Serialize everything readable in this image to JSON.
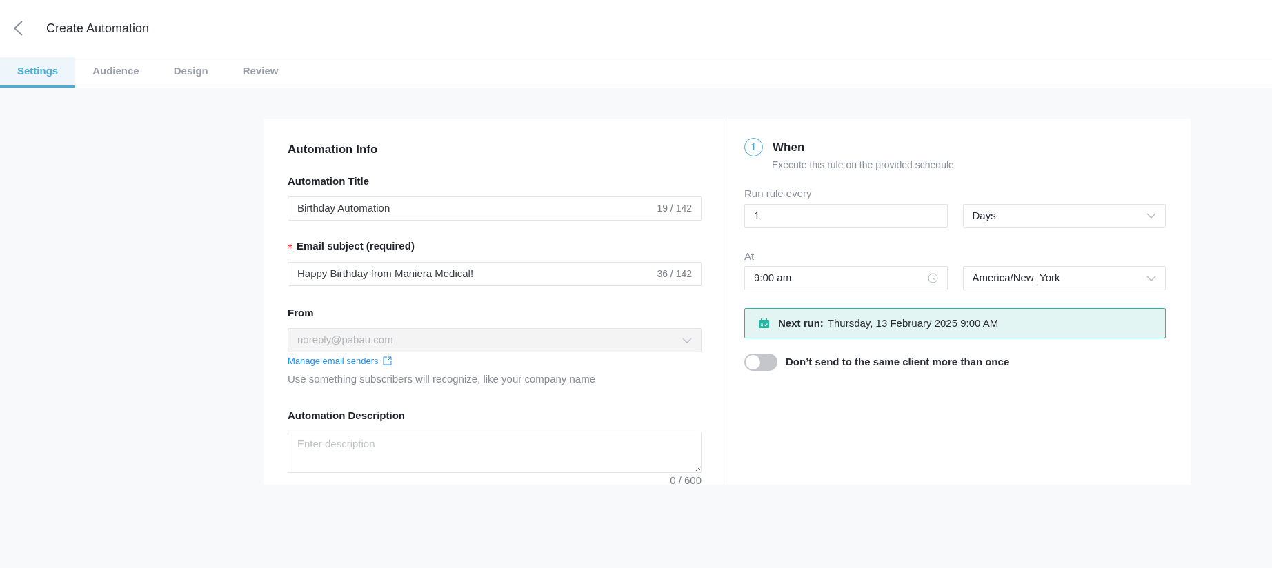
{
  "header": {
    "title": "Create Automation"
  },
  "tabs": [
    {
      "label": "Settings",
      "selected": true
    },
    {
      "label": "Audience",
      "selected": false
    },
    {
      "label": "Design",
      "selected": false
    },
    {
      "label": "Review",
      "selected": false
    }
  ],
  "automation_info": {
    "heading": "Automation Info",
    "title_field": {
      "label": "Automation Title",
      "value": "Birthday Automation",
      "counter": "19 / 142"
    },
    "subject_field": {
      "label": "Email subject (required)",
      "required": true,
      "value": "Happy Birthday from Maniera Medical!",
      "counter": "36 / 142"
    },
    "from_field": {
      "label": "From",
      "value": "noreply@pabau.com",
      "disabled": true,
      "link": "Manage email senders",
      "help": "Use something subscribers will recognize, like your company name"
    },
    "description_field": {
      "label": "Automation Description",
      "placeholder": "Enter description",
      "counter": "0 / 600"
    }
  },
  "when": {
    "step": "1",
    "title": "When",
    "subtitle": "Execute this rule on the provided schedule",
    "run_every_label": "Run rule every",
    "run_every_value": "1",
    "unit": "Days",
    "at_label": "At",
    "time": "9:00 am",
    "timezone": "America/New_York",
    "next_run_label": "Next run:",
    "next_run_value": "Thursday, 13 February 2025 9:00 AM",
    "toggle": {
      "label": "Don’t send to the same client more than once",
      "on": false
    }
  }
}
